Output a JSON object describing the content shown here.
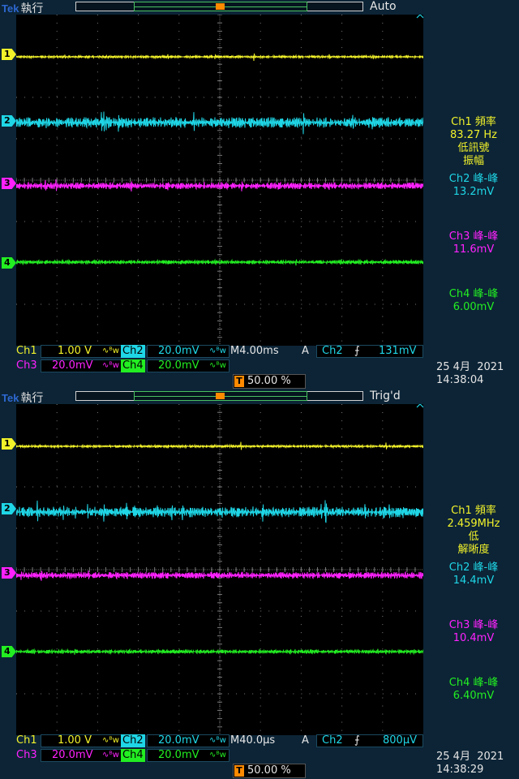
{
  "colors": {
    "ch1": "#f2f22a",
    "ch2": "#1fd6e6",
    "ch3": "#ff22ff",
    "ch4": "#22ee22",
    "trigger": "#ff8a00",
    "grid": "#7a7a7a"
  },
  "panels": [
    {
      "brand": "Tek",
      "run_state": "執行",
      "trigger_status": "Auto",
      "channel_markers": [
        "1",
        "2",
        "3",
        "4"
      ],
      "trigger_marker": "T",
      "measurements": [
        {
          "lines": [
            "Ch1 頻率",
            "83.27 Hz",
            "低訊號",
            "振幅"
          ]
        },
        {
          "lines": [
            "Ch2 峰-峰",
            "13.2mV"
          ]
        },
        {
          "lines": [
            "Ch3 峰-峰",
            "11.6mV"
          ]
        },
        {
          "lines": [
            "Ch4 峰-峰",
            "6.00mV"
          ]
        }
      ],
      "status_row1": {
        "ch1": "Ch1",
        "ch1_scale": "1.00 V",
        "ch1_coupling": "∿ᴮw",
        "ch2": "Ch2",
        "ch2_scale": "20.0mV",
        "ch2_coupling": "∿ᴮw",
        "timebase": "M4.00ms",
        "trig_mode": "A",
        "trig_ch": "Ch2",
        "trig_slope": "⨍",
        "trig_level": "131mV"
      },
      "status_row2": {
        "ch3": "Ch3",
        "ch3_scale": "20.0mV",
        "ch3_coupling": "∿ᴮw",
        "ch4": "Ch4",
        "ch4_scale": "20.0mV",
        "ch4_coupling": "∿ᴮw"
      },
      "trigger_position": {
        "label": "T",
        "value": "50.00 %"
      },
      "date": "25 4月  2021",
      "time": "14:38:04"
    },
    {
      "brand": "Tek",
      "run_state": "執行",
      "trigger_status": "Trig'd",
      "channel_markers": [
        "1",
        "2",
        "3",
        "4"
      ],
      "trigger_marker": "T",
      "measurements": [
        {
          "lines": [
            "Ch1 頻率",
            "2.459MHz",
            "低",
            "解晰度"
          ]
        },
        {
          "lines": [
            "Ch2 峰-峰",
            "14.4mV"
          ]
        },
        {
          "lines": [
            "Ch3 峰-峰",
            "10.4mV"
          ]
        },
        {
          "lines": [
            "Ch4 峰-峰",
            "6.40mV"
          ]
        }
      ],
      "status_row1": {
        "ch1": "Ch1",
        "ch1_scale": "1.00 V",
        "ch1_coupling": "∿ᴮw",
        "ch2": "Ch2",
        "ch2_scale": "20.0mV",
        "ch2_coupling": "∿ᴮw",
        "timebase": "M40.0µs",
        "trig_mode": "A",
        "trig_ch": "Ch2",
        "trig_slope": "⨍",
        "trig_level": "800µV"
      },
      "status_row2": {
        "ch3": "Ch3",
        "ch3_scale": "20.0mV",
        "ch3_coupling": "∿ᴮw",
        "ch4": "Ch4",
        "ch4_scale": "20.0mV",
        "ch4_coupling": "∿ᴮw"
      },
      "trigger_position": {
        "label": "T",
        "value": "50.00 %"
      },
      "date": "25 4月  2021",
      "time": "14:38:29"
    }
  ]
}
